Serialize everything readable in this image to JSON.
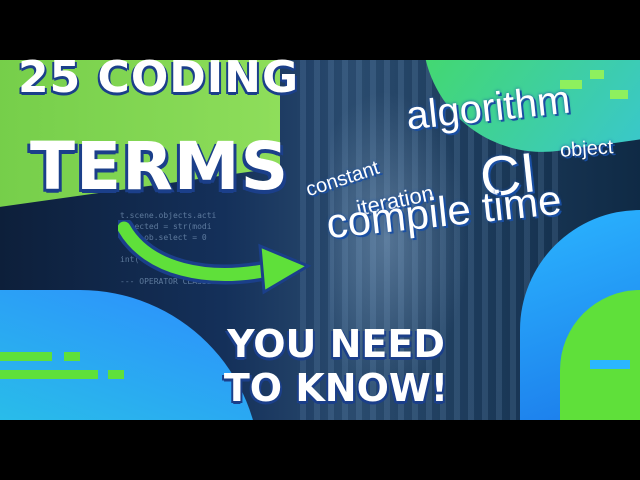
{
  "title": {
    "line1": "25 CODING",
    "line2": "TERMS"
  },
  "subtitle": {
    "line1": "YOU NEED",
    "line2": "TO KNOW!"
  },
  "word_cloud": {
    "algorithm": "algorithm",
    "object": "object",
    "constant": "constant",
    "ci": "CI",
    "iteration": "iteration",
    "compile_time": "compile time"
  },
  "code_text": "t.scene.objects.acti\nselected = str(modi\n     ob.select = 0\n\nint(\"please\n\n--- OPERATOR CLASSES",
  "colors": {
    "green": "#6fe63d",
    "blue": "#2a7ff7",
    "title_shadow": "#1b3f8a"
  },
  "icons": {
    "arrow": "curved-right-arrow-icon"
  }
}
